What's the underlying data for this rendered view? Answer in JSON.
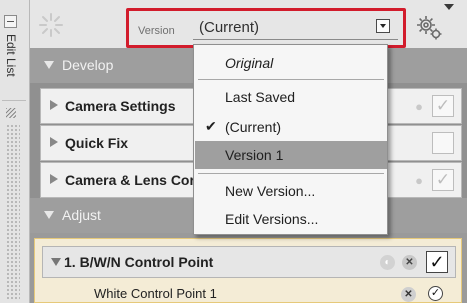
{
  "sidebar": {
    "label": "Edit List"
  },
  "toolbar": {
    "version_label": "Version",
    "version_value": "(Current)",
    "gear_icon": "gear-icon",
    "busy_icon": "spinner-icon"
  },
  "sections": {
    "develop": "Develop",
    "adjust": "Adjust"
  },
  "develop_items": [
    {
      "label": "Camera Settings",
      "checked": true
    },
    {
      "label": "Quick Fix",
      "checked": false
    },
    {
      "label": "Camera & Lens Corrections",
      "checked": true
    }
  ],
  "adjust": {
    "control_point": {
      "title": "1. B/W/N Control Point",
      "checked": true,
      "child": "White Control Point 1"
    }
  },
  "version_menu": {
    "items": [
      {
        "label": "Original",
        "italic": true
      },
      {
        "label": "Last Saved"
      },
      {
        "label": "(Current)",
        "checked": true
      },
      {
        "label": "Version 1",
        "highlighted": true
      },
      {
        "label": "New Version..."
      },
      {
        "label": "Edit Versions..."
      }
    ]
  },
  "colors": {
    "highlight_border": "#d21c2c",
    "menu_selected": "#9f9f9f",
    "control_point_panel": "#f4ecd6"
  }
}
